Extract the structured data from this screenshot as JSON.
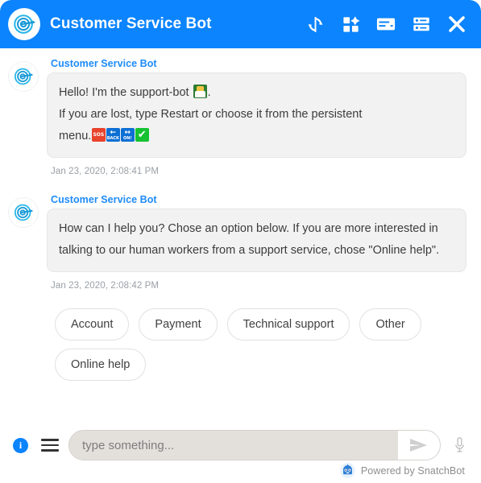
{
  "window": {
    "title": "Customer Service Bot",
    "accent_color": "#0b84fe",
    "avatar_icon": "target-icon"
  },
  "header": {
    "title": "Customer Service Bot",
    "actions": [
      {
        "name": "restart-icon",
        "label": "Restart"
      },
      {
        "name": "apps-icon",
        "label": "Apps"
      },
      {
        "name": "card-icon",
        "label": "Card"
      },
      {
        "name": "list-icon",
        "label": "List"
      },
      {
        "name": "close-icon",
        "label": "Close"
      }
    ]
  },
  "conversation": {
    "messages": [
      {
        "sender": "Customer Service Bot",
        "line1": "Hello! I'm the support-bot ",
        "line1_suffix": ".",
        "line2": "If you are lost, type Restart or choose it from the persistent",
        "line3": "menu.",
        "emojis_inline": [
          "person-emoji"
        ],
        "emojis_trailing": [
          "sos-emoji",
          "back-emoji",
          "on-emoji",
          "check-mark-emoji"
        ],
        "timestamp": "Jan 23, 2020, 2:08:41 PM"
      },
      {
        "sender": "Customer Service Bot",
        "text": "How can I help you? Chose an option below. If you are more interested in talking to our human workers from a support service, chose \"Online help\".",
        "timestamp": "Jan 23, 2020, 2:08:42 PM"
      }
    ],
    "quick_replies": [
      {
        "label": "Account"
      },
      {
        "label": "Payment"
      },
      {
        "label": "Technical support"
      },
      {
        "label": "Other"
      },
      {
        "label": "Online help"
      }
    ]
  },
  "composer": {
    "info_label": "i",
    "menu_icon": "hamburger-menu-icon",
    "input_value": "",
    "input_placeholder": "type something...",
    "send_icon": "send-arrow-icon",
    "mic_icon": "microphone-icon"
  },
  "footer": {
    "powered_text": "Powered by SnatchBot",
    "logo_icon": "snatchbot-logo-icon"
  }
}
